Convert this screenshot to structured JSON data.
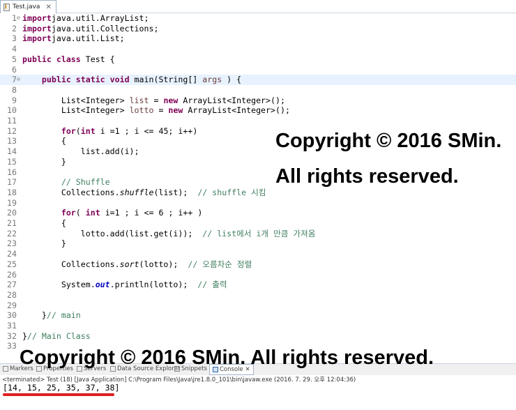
{
  "editor_tab": {
    "label": "Test.java",
    "close": "✕"
  },
  "lines": [
    {
      "n": "1",
      "m": "⊖",
      "tokens": [
        [
          "kw",
          "import"
        ],
        [
          "",
          "java.util.ArrayList;"
        ]
      ]
    },
    {
      "n": "2",
      "tokens": [
        [
          "kw",
          "import"
        ],
        [
          "",
          "java.util.Collections;"
        ]
      ]
    },
    {
      "n": "3",
      "tokens": [
        [
          "kw",
          "import"
        ],
        [
          "",
          "java.util.List;"
        ]
      ]
    },
    {
      "n": "4",
      "tokens": []
    },
    {
      "n": "5",
      "tokens": [
        [
          "kw",
          "public class"
        ],
        [
          "",
          " Test {"
        ]
      ]
    },
    {
      "n": "6",
      "tokens": []
    },
    {
      "n": "7",
      "m": "⊖",
      "hl": true,
      "tokens": [
        [
          "",
          "    "
        ],
        [
          "kw",
          "public static void"
        ],
        [
          "",
          " main(String[] "
        ],
        [
          "vr",
          "args"
        ],
        [
          "",
          " ) {"
        ]
      ]
    },
    {
      "n": "8",
      "tokens": []
    },
    {
      "n": "9",
      "tokens": [
        [
          "",
          "        List<Integer> "
        ],
        [
          "vr",
          "list"
        ],
        [
          "",
          " = "
        ],
        [
          "kw",
          "new"
        ],
        [
          "",
          " ArrayList<Integer>();"
        ]
      ]
    },
    {
      "n": "10",
      "tokens": [
        [
          "",
          "        List<Integer> "
        ],
        [
          "vr",
          "lotto"
        ],
        [
          "",
          " = "
        ],
        [
          "kw",
          "new"
        ],
        [
          "",
          " ArrayList<Integer>();"
        ]
      ]
    },
    {
      "n": "11",
      "tokens": []
    },
    {
      "n": "12",
      "tokens": [
        [
          "",
          "        "
        ],
        [
          "kw",
          "for"
        ],
        [
          "",
          "("
        ],
        [
          "kw",
          "int"
        ],
        [
          "",
          " i =1 ; i <= 45; i++)"
        ]
      ]
    },
    {
      "n": "13",
      "tokens": [
        [
          "",
          "        {"
        ]
      ]
    },
    {
      "n": "14",
      "tokens": [
        [
          "",
          "            list.add(i);"
        ]
      ]
    },
    {
      "n": "15",
      "tokens": [
        [
          "",
          "        }"
        ]
      ]
    },
    {
      "n": "16",
      "tokens": []
    },
    {
      "n": "17",
      "tokens": [
        [
          "",
          "        "
        ],
        [
          "cm",
          "// Shuffle"
        ]
      ]
    },
    {
      "n": "18",
      "tokens": [
        [
          "",
          "        Collections."
        ],
        [
          "it",
          "shuffle"
        ],
        [
          "",
          "(list);  "
        ],
        [
          "cm",
          "// shuffle 시킴"
        ]
      ]
    },
    {
      "n": "19",
      "tokens": []
    },
    {
      "n": "20",
      "tokens": [
        [
          "",
          "        "
        ],
        [
          "kw",
          "for"
        ],
        [
          "",
          "( "
        ],
        [
          "kw",
          "int"
        ],
        [
          "",
          " i=1 ; i <= 6 ; i++ )"
        ]
      ]
    },
    {
      "n": "21",
      "tokens": [
        [
          "",
          "        {"
        ]
      ]
    },
    {
      "n": "22",
      "tokens": [
        [
          "",
          "            lotto.add(list.get(i));  "
        ],
        [
          "cm",
          "// list에서 i개 만큼 가져옴"
        ]
      ]
    },
    {
      "n": "23",
      "tokens": [
        [
          "",
          "        }"
        ]
      ]
    },
    {
      "n": "24",
      "tokens": []
    },
    {
      "n": "25",
      "tokens": [
        [
          "",
          "        Collections."
        ],
        [
          "it",
          "sort"
        ],
        [
          "",
          "(lotto);  "
        ],
        [
          "cm",
          "// 오름차순 정렬"
        ]
      ]
    },
    {
      "n": "26",
      "tokens": []
    },
    {
      "n": "27",
      "tokens": [
        [
          "",
          "        System."
        ],
        [
          "fld",
          "out"
        ],
        [
          "",
          ".println(lotto);  "
        ],
        [
          "cm",
          "// 출력"
        ]
      ]
    },
    {
      "n": "28",
      "tokens": []
    },
    {
      "n": "29",
      "tokens": []
    },
    {
      "n": "30",
      "tokens": [
        [
          "",
          "    }"
        ],
        [
          "cm",
          "// main"
        ]
      ]
    },
    {
      "n": "31",
      "tokens": []
    },
    {
      "n": "32",
      "tokens": [
        [
          "",
          "}"
        ],
        [
          "cm",
          "// Main Class"
        ]
      ]
    },
    {
      "n": "33",
      "tokens": []
    }
  ],
  "watermark": {
    "line1": "Copyright © 2016 SMin.",
    "line2": "All rights reserved.",
    "line3": "Copyright © 2016 SMin. All rights reserved."
  },
  "panel_tabs": [
    "Markers",
    "Properties",
    "Servers",
    "Data Source Explorer",
    "Snippets",
    "Console ✕"
  ],
  "console": {
    "status": "<terminated> Test (18) [Java Application] C:\\Program Files\\Java\\jre1.8.0_101\\bin\\javaw.exe (2016. 7. 29. 오후 12:04:36)",
    "output": "[14, 15, 25, 35, 37, 38]"
  }
}
